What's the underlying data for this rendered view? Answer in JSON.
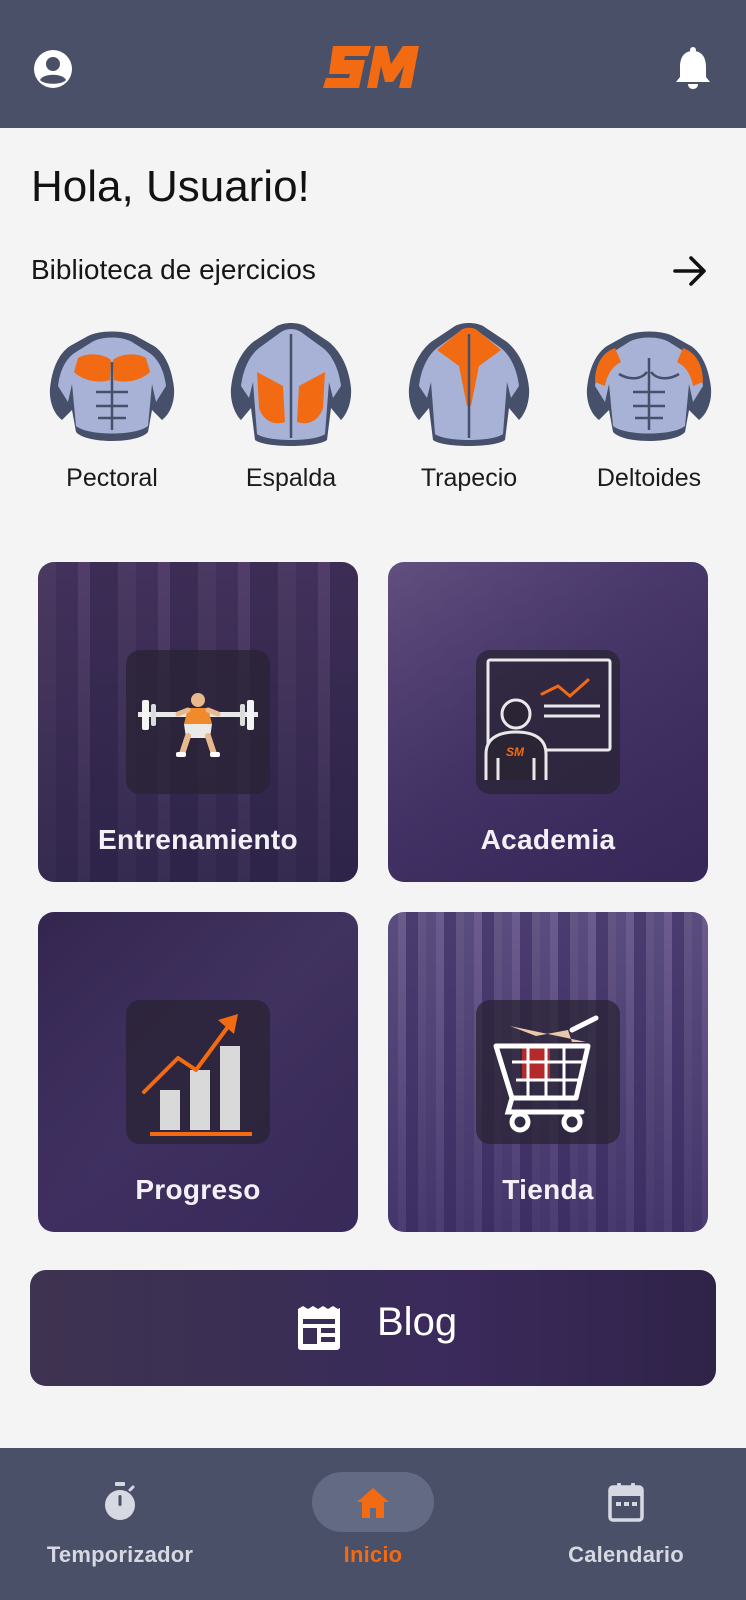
{
  "app": {
    "logo_text": "SM",
    "accent": "#f26a12",
    "header_bg": "#4a5068"
  },
  "header": {
    "profile_icon": "account-circle-icon",
    "notifications_icon": "bell-icon"
  },
  "greeting": "Hola, Usuario!",
  "library": {
    "title": "Biblioteca de ejercicios",
    "arrow_icon": "arrow-right-icon",
    "muscles": [
      {
        "label": "Pectoral",
        "icon": "pectoral-icon"
      },
      {
        "label": "Espalda",
        "icon": "back-icon"
      },
      {
        "label": "Trapecio",
        "icon": "trapezius-icon"
      },
      {
        "label": "Deltoides",
        "icon": "deltoid-icon"
      }
    ]
  },
  "tiles": [
    {
      "label": "Entrenamiento",
      "icon": "weightlifter-icon"
    },
    {
      "label": "Academia",
      "icon": "presentation-icon"
    },
    {
      "label": "Progreso",
      "icon": "bar-chart-trend-icon"
    },
    {
      "label": "Tienda",
      "icon": "shopping-cart-icon"
    }
  ],
  "blog": {
    "label": "Blog",
    "icon": "newspaper-icon"
  },
  "bottom_nav": {
    "items": [
      {
        "label": "Temporizador",
        "icon": "stopwatch-icon",
        "active": false
      },
      {
        "label": "Inicio",
        "icon": "home-icon",
        "active": true
      },
      {
        "label": "Calendario",
        "icon": "calendar-icon",
        "active": false
      }
    ]
  }
}
